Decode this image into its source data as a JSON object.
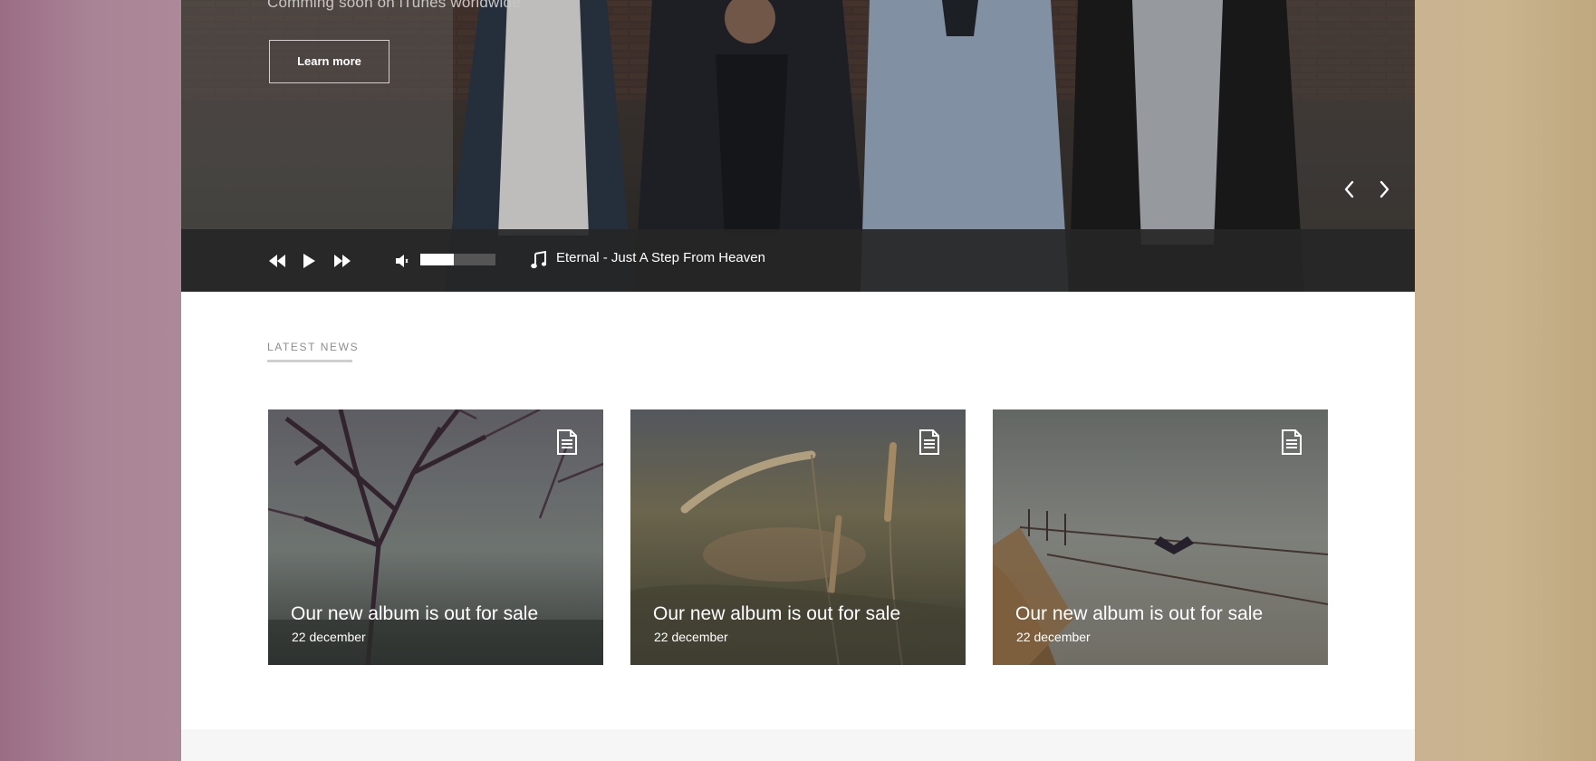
{
  "hero": {
    "subtitle": "Comming soon on iTunes worldwide",
    "learn_more_label": "Learn more",
    "prev_icon": "chevron-left-icon",
    "next_icon": "chevron-right-icon"
  },
  "player": {
    "controls": [
      "rewind-icon",
      "play-icon",
      "fast-forward-icon",
      "volume-icon",
      "music-note-icon"
    ],
    "volume_level": 0.45,
    "track_title": "Eternal - Just A Step From Heaven"
  },
  "news": {
    "section_title": "LATEST NEWS",
    "cards": [
      {
        "title": "Our new album is out for sale",
        "date": "22 december",
        "icon": "document-icon"
      },
      {
        "title": "Our new album is out for sale",
        "date": "22 december",
        "icon": "document-icon"
      },
      {
        "title": "Our new album is out for sale",
        "date": "22 december",
        "icon": "document-icon"
      }
    ]
  },
  "colors": {
    "player_bar": "#262626",
    "page_bg": "#ffffff",
    "text_white": "#ffffff",
    "section_title": "#8e8e8e",
    "footer_strip": "#f6f6f6"
  }
}
